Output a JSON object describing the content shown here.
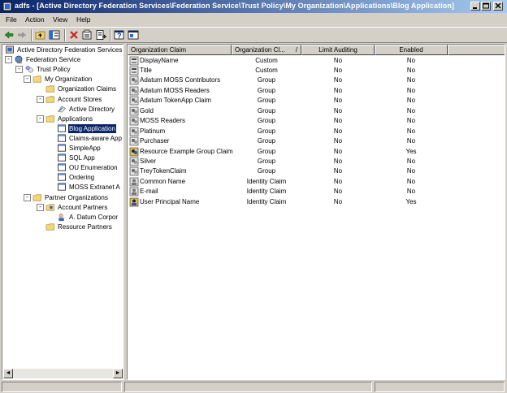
{
  "window": {
    "title": "adfs - [Active Directory Federation Services\\Federation Service\\Trust Policy\\My Organization\\Applications\\Blog Application]",
    "controls": {
      "minimize": "_",
      "maximize": "□",
      "close": "×"
    }
  },
  "menu": {
    "items": [
      "File",
      "Action",
      "View",
      "Help"
    ]
  },
  "toolbar": {
    "buttons": [
      "back-icon",
      "forward-icon",
      "up-folder-icon",
      "show-hide-tree-icon",
      "delete-icon",
      "properties-icon",
      "export-list-icon",
      "help-icon",
      "console-icon"
    ]
  },
  "tree": {
    "nodes": [
      {
        "label": "Active Directory Federation Services",
        "icon": "adfs-root-icon"
      },
      {
        "label": "Federation Service",
        "icon": "federation-service-icon",
        "expander": "-"
      },
      {
        "label": "Trust Policy",
        "icon": "trust-policy-icon",
        "expander": "-"
      },
      {
        "label": "My Organization",
        "icon": "folder-icon",
        "expander": "-"
      },
      {
        "label": "Organization Claims",
        "icon": "folder-icon"
      },
      {
        "label": "Account Stores",
        "icon": "folder-icon",
        "expander": "-"
      },
      {
        "label": "Active Directory",
        "icon": "active-directory-icon"
      },
      {
        "label": "Applications",
        "icon": "folder-icon",
        "expander": "-"
      },
      {
        "label": "Blog Application",
        "icon": "application-icon",
        "selected": true
      },
      {
        "label": "Claims-aware App",
        "icon": "application-icon"
      },
      {
        "label": "SimpleApp",
        "icon": "application-icon"
      },
      {
        "label": "SQL App",
        "icon": "application-icon"
      },
      {
        "label": "OU Enumeration",
        "icon": "application-icon"
      },
      {
        "label": "Ordering",
        "icon": "application-icon"
      },
      {
        "label": "MOSS Extranet A",
        "icon": "application-icon"
      },
      {
        "label": "Partner Organizations",
        "icon": "folder-icon",
        "expander": "-"
      },
      {
        "label": "Account Partners",
        "icon": "account-partners-icon",
        "expander": "-"
      },
      {
        "label": "A. Datum Corpor",
        "icon": "partner-icon"
      },
      {
        "label": "Resource Partners",
        "icon": "folder-icon"
      }
    ],
    "scroll_left": "◄",
    "scroll_right": "►"
  },
  "list": {
    "columns": [
      "Organization Claim",
      "Organization Cl...",
      "Limit Auditing",
      "Enabled"
    ],
    "sort_indicator": "/",
    "rows": [
      {
        "claim": "DisplayName",
        "type": "Custom",
        "limit": "No",
        "enabled": "No",
        "icon": "custom-claim-icon"
      },
      {
        "claim": "Title",
        "type": "Custom",
        "limit": "No",
        "enabled": "No",
        "icon": "custom-claim-icon"
      },
      {
        "claim": "Adatum MOSS Contributors",
        "type": "Group",
        "limit": "No",
        "enabled": "No",
        "icon": "group-claim-icon"
      },
      {
        "claim": "Adatum MOSS Readers",
        "type": "Group",
        "limit": "No",
        "enabled": "No",
        "icon": "group-claim-icon"
      },
      {
        "claim": "Adatum TokenApp Claim",
        "type": "Group",
        "limit": "No",
        "enabled": "No",
        "icon": "group-claim-icon"
      },
      {
        "claim": "Gold",
        "type": "Group",
        "limit": "No",
        "enabled": "No",
        "icon": "group-claim-icon"
      },
      {
        "claim": "MOSS Readers",
        "type": "Group",
        "limit": "No",
        "enabled": "No",
        "icon": "group-claim-icon"
      },
      {
        "claim": "Platinum",
        "type": "Group",
        "limit": "No",
        "enabled": "No",
        "icon": "group-claim-icon"
      },
      {
        "claim": "Purchaser",
        "type": "Group",
        "limit": "No",
        "enabled": "No",
        "icon": "group-claim-icon"
      },
      {
        "claim": "Resource Example Group Claim",
        "type": "Group",
        "limit": "No",
        "enabled": "Yes",
        "icon": "group-claim-enabled-icon"
      },
      {
        "claim": "Silver",
        "type": "Group",
        "limit": "No",
        "enabled": "No",
        "icon": "group-claim-icon"
      },
      {
        "claim": "TreyTokenClaim",
        "type": "Group",
        "limit": "No",
        "enabled": "No",
        "icon": "group-claim-icon"
      },
      {
        "claim": "Common Name",
        "type": "Identity Claim",
        "limit": "No",
        "enabled": "No",
        "icon": "identity-claim-icon"
      },
      {
        "claim": "E-mail",
        "type": "Identity Claim",
        "limit": "No",
        "enabled": "No",
        "icon": "identity-claim-icon"
      },
      {
        "claim": "User Principal Name",
        "type": "Identity Claim",
        "limit": "No",
        "enabled": "Yes",
        "icon": "identity-claim-enabled-icon"
      }
    ]
  },
  "colors": {
    "title_start": "#0a246a",
    "title_end": "#a6caf0",
    "selection": "#0a246a",
    "face": "#d4d0c8"
  }
}
